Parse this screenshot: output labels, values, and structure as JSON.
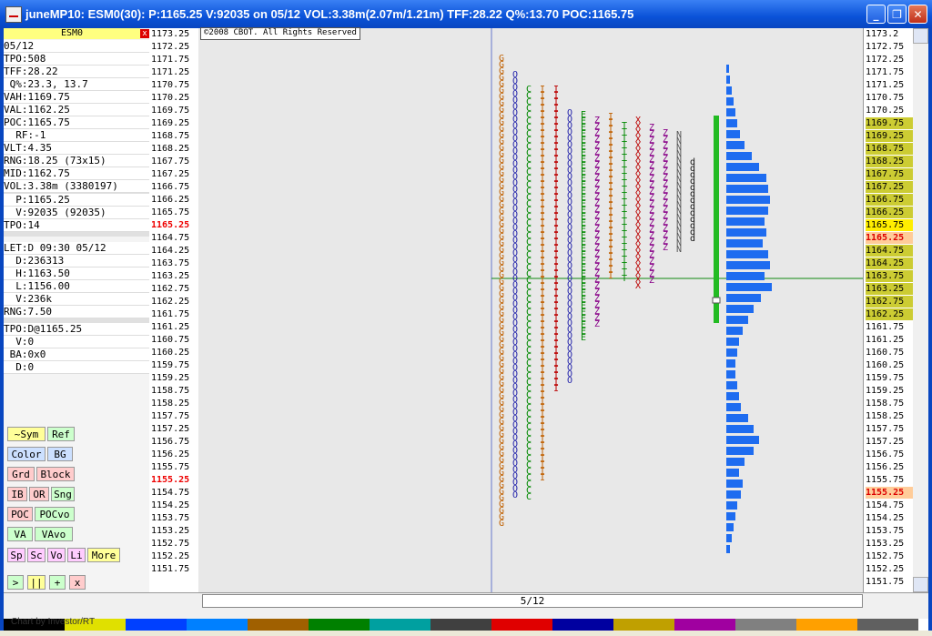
{
  "window": {
    "title": "juneMP10: ESM0(30): P:1165.25 V:92035 on 05/12 VOL:3.38m(2.07m/1.21m)  TFF:28.22 Q%:13.70 POC:1165.75",
    "minimize": "_",
    "restore": "❐",
    "close": "✕"
  },
  "symbol": {
    "name": "ESM0",
    "close": "x"
  },
  "stats": {
    "date": "05/12",
    "tpo": "TPO:508",
    "tff": "TFF:28.22",
    "q": " Q%:23.3, 13.7",
    "vah": "VAH:1169.75",
    "val": "VAL:1162.25",
    "poc": "POC:1165.75",
    "rf": "  RF:-1",
    "vlt": "VLT:4.35",
    "rng": "RNG:18.25 (73x15)",
    "mid": "MID:1162.75",
    "vol": "VOL:3.38m (3380197)",
    "p": "  P:1165.25",
    "v": "  V:92035 (92035)",
    "tpo2": "TPO:14",
    "let": "LET:D 09:30 05/12",
    "d": "  D:236313",
    "h": "  H:1163.50",
    "l": "  L:1156.00",
    "lv": "  V:236k",
    "rng2": "RNG:7.50",
    "tpod": "TPO:D@1165.25",
    "v0": "  V:0",
    "ba": " BA:0x0",
    "d0": "  D:0"
  },
  "buttons": [
    [
      "~Sym",
      "Ref"
    ],
    [
      "Color",
      "BG"
    ],
    [
      "Grd",
      "Block"
    ],
    [
      "IB",
      "OR",
      "Sng"
    ],
    [
      "POC",
      "POCvo"
    ],
    [
      "VA",
      "VAvo"
    ],
    [
      "Sp",
      "Sc",
      "Vo",
      "Li",
      "More"
    ],
    [
      ">",
      "||",
      "+",
      "x"
    ]
  ],
  "prices_left": [
    "1173.25",
    "1172.25",
    "1171.75",
    "1171.25",
    "1170.75",
    "1170.25",
    "1169.75",
    "1169.25",
    "1168.75",
    "1168.25",
    "1167.75",
    "1167.25",
    "1166.75",
    "1166.25",
    "1165.75",
    "1165.25",
    "1164.75",
    "1164.25",
    "1163.75",
    "1163.25",
    "1162.75",
    "1162.25",
    "1161.75",
    "1161.25",
    "1160.75",
    "1160.25",
    "1159.75",
    "1159.25",
    "1158.75",
    "1158.25",
    "1157.75",
    "1157.25",
    "1156.75",
    "1156.25",
    "1155.75",
    "1155.25",
    "1154.75",
    "1154.25",
    "1153.75",
    "1153.25",
    "1152.75",
    "1152.25",
    "1151.75"
  ],
  "prices_right": [
    "1173.2",
    "1172.75",
    "1172.25",
    "1171.75",
    "1171.25",
    "1170.75",
    "1170.25",
    "1169.75",
    "1169.25",
    "1168.75",
    "1168.25",
    "1167.75",
    "1167.25",
    "1166.75",
    "1166.25",
    "1165.75",
    "1165.25",
    "1164.75",
    "1164.25",
    "1163.75",
    "1163.25",
    "1162.75",
    "1162.25",
    "1161.75",
    "1161.25",
    "1160.75",
    "1160.25",
    "1159.75",
    "1159.25",
    "1158.75",
    "1158.25",
    "1157.75",
    "1157.25",
    "1156.75",
    "1156.25",
    "1155.75",
    "1155.25",
    "1154.75",
    "1154.25",
    "1153.75",
    "1153.25",
    "1152.75",
    "1152.25",
    "1151.75"
  ],
  "copyright": "©2008 CBOT. All Rights Reserved",
  "date_label": "5/12",
  "credit": "Chart by Investor/RT",
  "colors": {
    "va": "#cccc33",
    "poc": "#ffee00",
    "bars": "#1e6cf0",
    "green": "#22bb22"
  }
}
